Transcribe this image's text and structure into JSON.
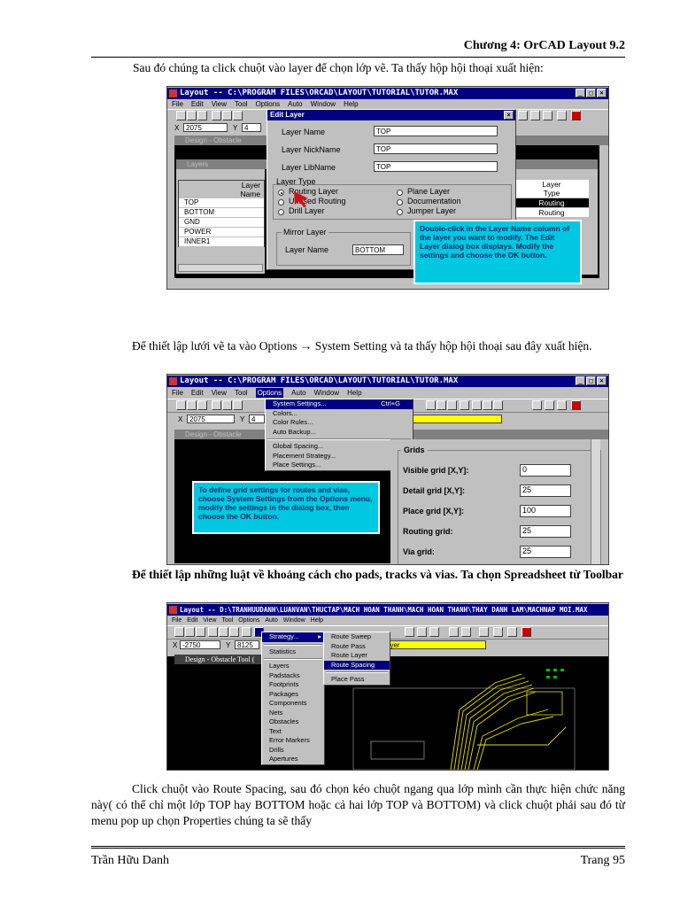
{
  "header": {
    "title": "Chương 4: OrCAD Layout 9.2"
  },
  "paragraphs": {
    "p1": "Sau đó chúng ta click chuột vào layer để chọn lớp vẽ. Ta thấy hộp hội thoại xuất hiện:",
    "p2": "Để thiết lập lưới vẽ ta vào Options → System Setting và ta thấy hộp hội thoại sau đây xuất hiện.",
    "p3": "Để thiết lập những luật về khoảng cách cho pads, tracks và vias. Ta chọn Spreadsheet từ Toolbar",
    "p4": "Click chuột vào Route Spacing, sau đó chọn kéo chuột ngang qua lớp mình cần thực hiện chức năng này( có thể chỉ một lớp TOP hay BOTTOM hoặc cả hai lớp TOP và BOTTOM) và click chuột phải sau đó từ menu pop up chọn Properties chúng ta sẽ thấy"
  },
  "shot1": {
    "title": "Layout -- C:\\PROGRAM FILES\\ORCAD\\LAYOUT\\TUTORIAL\\TUTOR.MAX",
    "menu": [
      "File",
      "Edit",
      "View",
      "Tool",
      "Options",
      "Auto",
      "Window",
      "Help"
    ],
    "coord_x": "2075",
    "coord_y": "4",
    "design_title": "Design - Obstacle",
    "layers_title": "Layers",
    "layers_header": [
      "Layer",
      "Name"
    ],
    "layers_rows": [
      "TOP",
      "BOTTOM",
      "GND",
      "POWER",
      "INNER1"
    ],
    "right_header": [
      "Layer",
      "Type"
    ],
    "right_rows": [
      "Routing",
      "Routing"
    ],
    "dialog": {
      "title": "Edit Layer",
      "layer_name_label": "Layer Name",
      "layer_name": "TOP",
      "nickname_label": "Layer NickName",
      "nickname": "TOP",
      "libname_label": "Layer LibName",
      "libname": "TOP",
      "type_label": "Layer Type",
      "types_left": [
        "Routing Layer",
        "Unused Routing",
        "Drill Layer"
      ],
      "types_right": [
        "Plane Layer",
        "Documentation",
        "Jumper Layer"
      ],
      "mirror_label": "Mirror Layer",
      "mirror_name_label": "Layer Name",
      "mirror_name": "BOTTOM"
    },
    "callout": "Double-click in the Layer Name column of the layer you want to modify. The Edit Layer dialog box displays. Modify the settings and choose the OK button."
  },
  "shot2": {
    "title": "Layout -- C:\\PROGRAM FILES\\ORCAD\\LAYOUT\\TUTORIAL\\TUTOR.MAX",
    "menu": [
      "File",
      "Edit",
      "View",
      "Tool",
      "Options",
      "Auto",
      "Window",
      "Help"
    ],
    "coord_x": "2075",
    "coord_y": "4",
    "design_title": "Design - Obstacle",
    "options_menu": [
      "System Settings...",
      "Colors...",
      "Color Rules...",
      "Auto Backup...",
      "Global Spacing...",
      "Placement Strategy...",
      "Place Settings..."
    ],
    "shortcut": "Ctrl+G",
    "grids": {
      "title": "Grids",
      "visible_label": "Visible grid [X,Y]:",
      "visible": "0",
      "detail_label": "Detail grid [X,Y]:",
      "detail": "25",
      "place_label": "Place grid [X,Y]:",
      "place": "100",
      "routing_label": "Routing grid:",
      "routing": "25",
      "via_label": "Via grid:",
      "via": "25"
    },
    "callout": "To define grid settings for routes and vias, choose System Settings from the Options menu, modify the settings in the dialog box, then choose the OK button."
  },
  "shot3": {
    "title": "Layout -- D:\\TRANHUUDANH\\LUANVAN\\THUCTAP\\MACH HOAN THANH\\MACH HOAN THANH\\THAY DANH LAM\\MACHNAP MOI.MAX",
    "menu": [
      "File",
      "Edit",
      "View",
      "Tool",
      "Options",
      "Auto",
      "Window",
      "Help"
    ],
    "coord_x": "-2750",
    "coord_y": "8125",
    "design_title": "Design - Obstacle Tool (",
    "layer_field": "ayer",
    "menu1": [
      "Strategy...",
      "Statistics",
      "Layers",
      "Padstacks",
      "Footprints",
      "Packages",
      "Components",
      "Nets",
      "Obstacles",
      "Text",
      "Error Markers",
      "Drills",
      "Apertures"
    ],
    "menu2": [
      "Route Sweep",
      "Route Pass",
      "Route Layer",
      "Route Spacing",
      "Place Pass"
    ]
  },
  "footer": {
    "author": "Trần Hữu Danh",
    "page": "Trang 95"
  }
}
